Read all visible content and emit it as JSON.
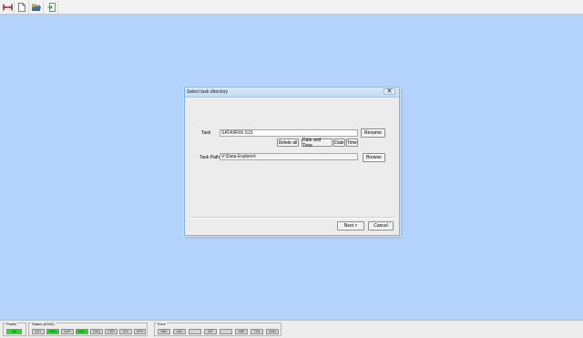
{
  "toolbar": {
    "buttons": [
      {
        "icon": "measure-width-icon"
      },
      {
        "icon": "new-document-icon"
      },
      {
        "icon": "open-folder-icon"
      },
      {
        "icon": "exit-icon"
      }
    ]
  },
  "dialog": {
    "title": "Select task directory",
    "close_icon": "close-icon",
    "task_label": "Task",
    "task_value": "SATA9R00.S15",
    "rename_label": "Rename",
    "delete_all_label": "Delete all",
    "date_and_time_label": "Date and Time",
    "date_label": "Date",
    "time_label": "Time",
    "task_path_label": "Task Path",
    "task_path_value": "V:\\Data Explorer\\",
    "browse_label": "Browse",
    "next_label": "Next >",
    "cancel_label": "Cancel"
  },
  "statusbar": {
    "power": {
      "title": "Power",
      "indicators": [
        {
          "label": "ON",
          "on": true
        }
      ]
    },
    "status": {
      "title": "Status (ATA2)",
      "indicators": [
        {
          "label": "BSY",
          "on": false
        },
        {
          "label": "DRD",
          "on": true
        },
        {
          "label": "DWF",
          "on": false
        },
        {
          "label": "DSC",
          "on": true
        },
        {
          "label": "DRQ",
          "on": false
        },
        {
          "label": "CRR",
          "on": false
        },
        {
          "label": "IDX",
          "on": false
        },
        {
          "label": "ERR",
          "on": false
        }
      ]
    },
    "error": {
      "title": "Error",
      "indicators": [
        {
          "label": "BBK",
          "on": false
        },
        {
          "label": "UNC",
          "on": false
        },
        {
          "label": "",
          "on": false
        },
        {
          "label": "INF",
          "on": false
        },
        {
          "label": "",
          "on": false
        },
        {
          "label": "ABR",
          "on": false
        },
        {
          "label": "T0N",
          "on": false
        },
        {
          "label": "AMN",
          "on": false
        }
      ]
    }
  }
}
